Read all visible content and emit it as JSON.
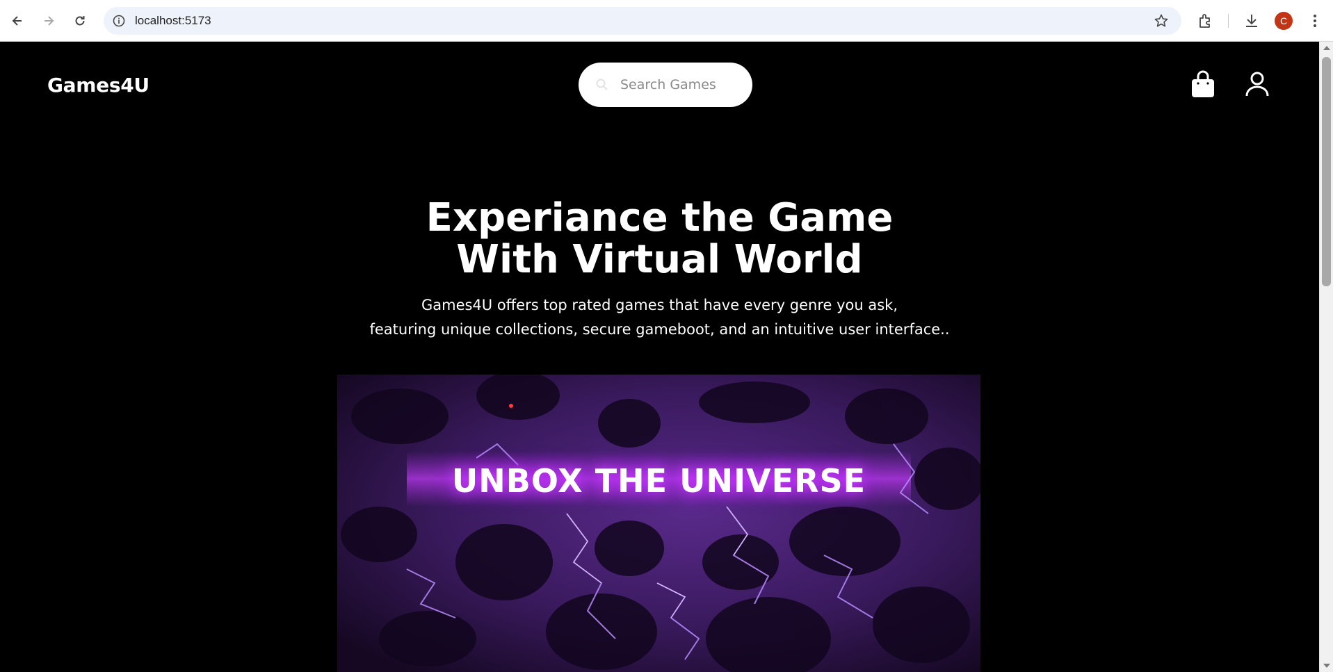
{
  "browser": {
    "url": "localhost:5173",
    "profile_initial": "C",
    "profile_color": "#c23616"
  },
  "header": {
    "brand": "Games4U",
    "search_placeholder": "Search Games",
    "cart_icon": "shopping-bag-icon",
    "user_icon": "user-icon"
  },
  "hero": {
    "title_line1": "Experiance the Game",
    "title_line2": "With Virtual World",
    "subtitle_line1": "Games4U offers top rated games that have every genre you ask,",
    "subtitle_line2": "featuring unique collections, secure gameboot, and an intuitive user interface.."
  },
  "banner": {
    "text": "UNBOX THE UNIVERSE",
    "accent_color": "#b02fe8"
  }
}
